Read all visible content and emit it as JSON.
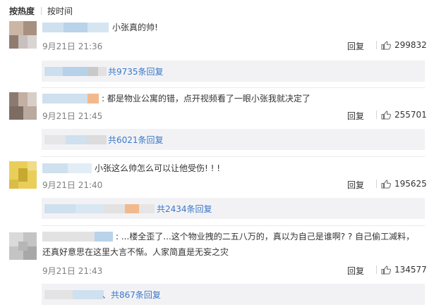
{
  "sort": {
    "hot": "按热度",
    "time": "按时间"
  },
  "comments": [
    {
      "text": "小张真的帅!",
      "time": "9月21日 21:36",
      "reply_label": "回复",
      "likes": "299832",
      "reply_count": "共9735条回复"
    },
    {
      "text": ": 都是物业公寓的错，点开视频看了一眼小张我就决定了",
      "time": "9月21日 21:45",
      "reply_label": "回复",
      "likes": "255701",
      "reply_count": "共6021条回复"
    },
    {
      "text": "小张这么帅怎么可以让他受伤! ! !",
      "time": "9月21日 21:40",
      "reply_label": "回复",
      "likes": "195625",
      "reply_count": "共2434条回复"
    },
    {
      "text": ": ...楼全歪了...这个物业拽的二五八万的，真以为自己是谁啊? ? 自己偷工减料，还真好意思在这里大言不惭。人家简直是无妄之灾",
      "time": "9月21日 21:43",
      "reply_label": "回复",
      "likes": "134577",
      "reply_count": "、共867条回复"
    }
  ],
  "colors": {
    "link": "#3a78c8",
    "muted": "#808080",
    "reply_bg": "#f2f2f5"
  },
  "icons": {
    "like": "thumbs-up-icon"
  }
}
